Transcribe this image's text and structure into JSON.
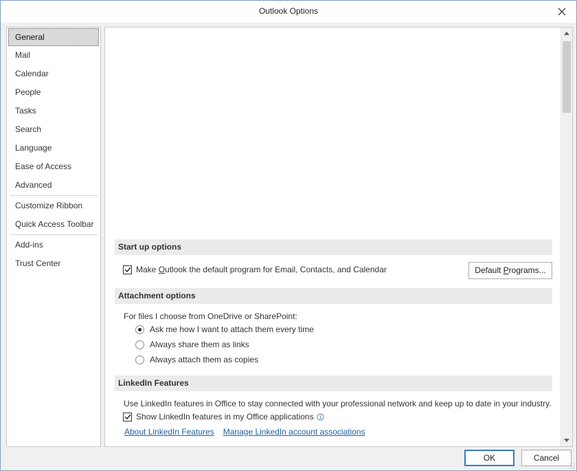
{
  "window": {
    "title": "Outlook Options"
  },
  "sidebar": {
    "items": [
      {
        "label": "General",
        "selected": true
      },
      {
        "label": "Mail"
      },
      {
        "label": "Calendar"
      },
      {
        "label": "People"
      },
      {
        "label": "Tasks"
      },
      {
        "label": "Search"
      },
      {
        "label": "Language"
      },
      {
        "label": "Ease of Access"
      },
      {
        "label": "Advanced"
      },
      {
        "label": "Customize Ribbon"
      },
      {
        "label": "Quick Access Toolbar"
      },
      {
        "label": "Add-ins"
      },
      {
        "label": "Trust Center"
      }
    ]
  },
  "startup": {
    "header": "Start up options",
    "default_checkbox_label_pre": "Make ",
    "default_checkbox_label_accel": "O",
    "default_checkbox_label_post": "utlook the default program for Email, Contacts, and Calendar",
    "default_checked": true,
    "default_programs_pre": "Default ",
    "default_programs_accel": "P",
    "default_programs_post": "rograms..."
  },
  "attachments": {
    "header": "Attachment options",
    "intro": "For files I choose from OneDrive or SharePoint:",
    "options": [
      {
        "label": "Ask me how I want to attach them every time",
        "selected": true
      },
      {
        "label": "Always share them as links",
        "selected": false
      },
      {
        "label": "Always attach them as copies",
        "selected": false
      }
    ]
  },
  "linkedin": {
    "header": "LinkedIn Features",
    "description": "Use LinkedIn features in Office to stay connected with your professional network and keep up to date in your industry.",
    "show_label": "Show LinkedIn features in my Office applications",
    "show_checked": true,
    "about_link": "About LinkedIn Features",
    "manage_link": "Manage LinkedIn account associations"
  },
  "footer": {
    "ok_label": "OK",
    "cancel_label": "Cancel"
  },
  "colors": {
    "accent": "#3a79c9",
    "link": "#1d5fa8",
    "section_bg": "#ebebeb"
  }
}
